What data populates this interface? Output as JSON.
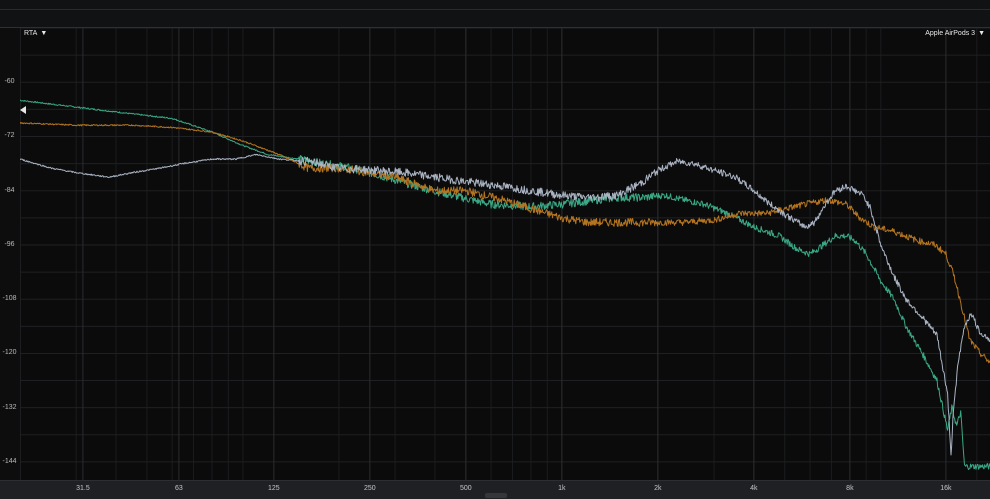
{
  "header": {
    "left_dropdown": "RTA",
    "right_dropdown": "Apple AirPods 3",
    "dropdown_icon": "triangle-down-icon"
  },
  "chart_data": {
    "type": "line",
    "xscale": "log",
    "xlim": [
      20,
      22000
    ],
    "ylim": [
      -148,
      -48
    ],
    "grid": true,
    "legend": "none",
    "xticks": [
      31.5,
      63,
      125,
      250,
      500,
      1000,
      2000,
      4000,
      8000,
      16000
    ],
    "xtick_labels": [
      "31.5",
      "63",
      "125",
      "250",
      "500",
      "1k",
      "2k",
      "4k",
      "8k",
      "16k"
    ],
    "yticks": [
      -60,
      -72,
      -84,
      -96,
      -108,
      -120,
      -132,
      -144
    ],
    "ytick_labels": [
      "-60",
      "-72",
      "-84",
      "-96",
      "-108",
      "-120",
      "-132",
      "-144"
    ],
    "series": [
      {
        "color": "#3aa884",
        "points": [
          [
            20,
            -64
          ],
          [
            30,
            -65.5
          ],
          [
            45,
            -67
          ],
          [
            60,
            -68
          ],
          [
            80,
            -71
          ],
          [
            100,
            -74
          ],
          [
            120,
            -76
          ],
          [
            150,
            -77
          ],
          [
            180,
            -78
          ],
          [
            220,
            -79
          ],
          [
            280,
            -81
          ],
          [
            350,
            -83
          ],
          [
            450,
            -85
          ],
          [
            600,
            -87
          ],
          [
            800,
            -87.5
          ],
          [
            1000,
            -87
          ],
          [
            1300,
            -86
          ],
          [
            1500,
            -85.5
          ],
          [
            1800,
            -85.5
          ],
          [
            2100,
            -85
          ],
          [
            2400,
            -86
          ],
          [
            2800,
            -87
          ],
          [
            3300,
            -89
          ],
          [
            4000,
            -92
          ],
          [
            4800,
            -94
          ],
          [
            5500,
            -97
          ],
          [
            6000,
            -98
          ],
          [
            6600,
            -96
          ],
          [
            7200,
            -94
          ],
          [
            7800,
            -94
          ],
          [
            8300,
            -95
          ],
          [
            9000,
            -98
          ],
          [
            10000,
            -104
          ],
          [
            11000,
            -108
          ],
          [
            12000,
            -114
          ],
          [
            13500,
            -120
          ],
          [
            15000,
            -126
          ],
          [
            16200,
            -137
          ],
          [
            16700,
            -132
          ],
          [
            17300,
            -136
          ],
          [
            17800,
            -133
          ],
          [
            18300,
            -145
          ],
          [
            19500,
            -145
          ],
          [
            22000,
            -145
          ]
        ]
      },
      {
        "color": "#b57520",
        "points": [
          [
            20,
            -69
          ],
          [
            30,
            -69.5
          ],
          [
            45,
            -69.5
          ],
          [
            60,
            -70
          ],
          [
            80,
            -71
          ],
          [
            100,
            -73
          ],
          [
            130,
            -76
          ],
          [
            160,
            -79
          ],
          [
            200,
            -79
          ],
          [
            250,
            -80
          ],
          [
            300,
            -81
          ],
          [
            400,
            -84
          ],
          [
            500,
            -84
          ],
          [
            650,
            -86
          ],
          [
            800,
            -88
          ],
          [
            1000,
            -90
          ],
          [
            1200,
            -91
          ],
          [
            1500,
            -91
          ],
          [
            1900,
            -91
          ],
          [
            2400,
            -91
          ],
          [
            3000,
            -90.5
          ],
          [
            3600,
            -89
          ],
          [
            4400,
            -89
          ],
          [
            5000,
            -88
          ],
          [
            5800,
            -87
          ],
          [
            6800,
            -86
          ],
          [
            7800,
            -87
          ],
          [
            8600,
            -90
          ],
          [
            9500,
            -92
          ],
          [
            11000,
            -93
          ],
          [
            13000,
            -95
          ],
          [
            14800,
            -96
          ],
          [
            16000,
            -98
          ],
          [
            17000,
            -103
          ],
          [
            18000,
            -110
          ],
          [
            19000,
            -117
          ],
          [
            20500,
            -120
          ],
          [
            22000,
            -122
          ]
        ]
      },
      {
        "color": "#a9b3c2",
        "points": [
          [
            20,
            -77
          ],
          [
            25,
            -79
          ],
          [
            30,
            -80
          ],
          [
            38,
            -81
          ],
          [
            45,
            -80
          ],
          [
            55,
            -79
          ],
          [
            65,
            -78
          ],
          [
            80,
            -77
          ],
          [
            95,
            -77
          ],
          [
            110,
            -76
          ],
          [
            130,
            -77
          ],
          [
            160,
            -77.5
          ],
          [
            200,
            -79
          ],
          [
            260,
            -79.5
          ],
          [
            320,
            -80
          ],
          [
            400,
            -81
          ],
          [
            500,
            -82
          ],
          [
            650,
            -83
          ],
          [
            800,
            -84
          ],
          [
            1000,
            -85
          ],
          [
            1200,
            -85.5
          ],
          [
            1500,
            -85
          ],
          [
            1800,
            -82
          ],
          [
            2000,
            -79.5
          ],
          [
            2300,
            -77.5
          ],
          [
            2600,
            -78
          ],
          [
            3000,
            -79.5
          ],
          [
            3500,
            -81
          ],
          [
            4000,
            -84
          ],
          [
            4500,
            -87
          ],
          [
            5200,
            -90
          ],
          [
            5800,
            -92
          ],
          [
            6200,
            -91
          ],
          [
            6700,
            -87
          ],
          [
            7200,
            -84
          ],
          [
            7800,
            -83
          ],
          [
            8300,
            -84
          ],
          [
            8800,
            -85
          ],
          [
            9300,
            -88
          ],
          [
            10000,
            -96
          ],
          [
            11000,
            -103
          ],
          [
            12000,
            -108
          ],
          [
            13500,
            -112
          ],
          [
            15000,
            -116
          ],
          [
            16200,
            -129
          ],
          [
            16600,
            -143
          ],
          [
            16900,
            -132
          ],
          [
            17500,
            -122
          ],
          [
            18300,
            -114
          ],
          [
            19200,
            -111
          ],
          [
            20300,
            -115
          ],
          [
            22000,
            -117
          ]
        ]
      }
    ]
  }
}
